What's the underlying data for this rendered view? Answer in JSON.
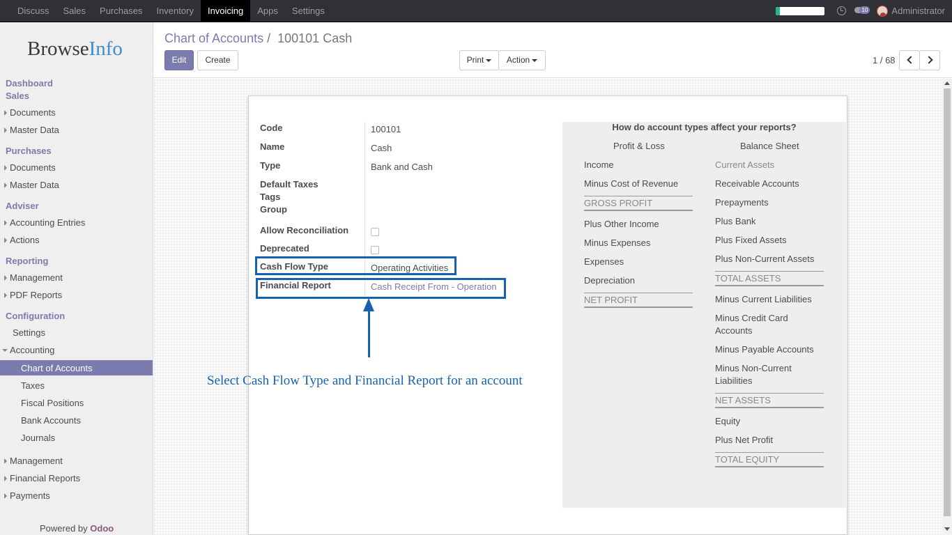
{
  "topbar": {
    "menu": [
      "Discuss",
      "Sales",
      "Purchases",
      "Inventory",
      "Invoicing",
      "Apps",
      "Settings"
    ],
    "active_index": 4,
    "chat_badge": "10",
    "user": "Administrator",
    "progress_fraction": 0.08
  },
  "sidebar": {
    "logo_part1": "Browse",
    "logo_part2": "Info",
    "dashboard": "Dashboard",
    "sales": "Sales",
    "sales_documents": "Documents",
    "sales_master": "Master Data",
    "purchases": "Purchases",
    "purch_documents": "Documents",
    "purch_master": "Master Data",
    "adviser": "Adviser",
    "acc_entries": "Accounting Entries",
    "actions": "Actions",
    "reporting": "Reporting",
    "management": "Management",
    "pdf_reports": "PDF Reports",
    "configuration": "Configuration",
    "settings": "Settings",
    "accounting": "Accounting",
    "chart_of_accounts": "Chart of Accounts",
    "taxes": "Taxes",
    "fiscal_positions": "Fiscal Positions",
    "bank_accounts": "Bank Accounts",
    "journals": "Journals",
    "management2": "Management",
    "financial_reports": "Financial Reports",
    "payments": "Payments",
    "powered_by": "Powered by",
    "odoo": "Odoo"
  },
  "control": {
    "breadcrumb_parent": "Chart of Accounts",
    "breadcrumb_sep": "/",
    "breadcrumb_current": "100101 Cash",
    "edit": "Edit",
    "create": "Create",
    "print": "Print",
    "action": "Action",
    "pager": "1 / 68"
  },
  "form": {
    "code_label": "Code",
    "code": "100101",
    "name_label": "Name",
    "name": "Cash",
    "type_label": "Type",
    "type": "Bank and Cash",
    "default_taxes_label": "Default Taxes",
    "tags_label": "Tags",
    "group_label": "Group",
    "allow_recon_label": "Allow Reconciliation",
    "deprecated_label": "Deprecated",
    "cash_flow_label": "Cash Flow Type",
    "cash_flow": "Operating Activities",
    "fin_report_label": "Financial Report",
    "fin_report": "Cash Receipt From - Operation"
  },
  "annotation": "Select Cash Flow Type and Financial Report for an account",
  "help": {
    "title": "How do account types affect your reports?",
    "pl_header": "Profit & Loss",
    "bs_header": "Balance Sheet",
    "pl": {
      "income": "Income",
      "cost": "Minus Cost of Revenue",
      "gross": "GROSS PROFIT",
      "other": "Plus Other Income",
      "expenses_minus": "Minus Expenses",
      "expenses": "Expenses",
      "depreciation": "Depreciation",
      "net": "NET PROFIT"
    },
    "bs": {
      "current_assets": "Current Assets",
      "receivable": "Receivable Accounts",
      "prepayments": "Prepayments",
      "bank": "Plus Bank",
      "fixed": "Plus Fixed Assets",
      "noncurrent": "Plus Non-Current Assets",
      "total_assets": "TOTAL ASSETS",
      "current_liab": "Minus Current Liabilities",
      "credit_card_1": "Minus Credit Card",
      "credit_card_2": "Accounts",
      "payable": "Minus Payable Accounts",
      "noncurrent_liab_1": "Minus Non-Current",
      "noncurrent_liab_2": "Liabilities",
      "net_assets": "NET ASSETS",
      "equity": "Equity",
      "net_profit": "Plus Net Profit",
      "total_equity": "TOTAL EQUITY"
    }
  }
}
